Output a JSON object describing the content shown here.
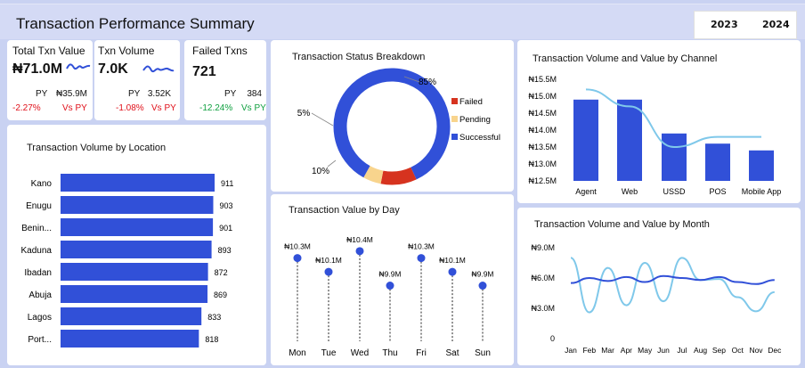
{
  "header": {
    "title": "Transaction Performance Summary",
    "years": [
      "2023",
      "2024"
    ]
  },
  "kpis": [
    {
      "label": "Total Txn Value",
      "value": "₦71.0M",
      "py_label": "PY",
      "py_value": "₦35.9M",
      "change": "-2.27%",
      "vs": "Vs PY",
      "trend": "negative"
    },
    {
      "label": "Txn Volume",
      "value": "7.0K",
      "py_label": "PY",
      "py_value": "3.52K",
      "change": "-1.08%",
      "vs": "Vs PY",
      "trend": "negative"
    },
    {
      "label": "Failed Txns",
      "value": "721",
      "py_label": "PY",
      "py_value": "384",
      "change": "-12.24%",
      "vs": "Vs PY",
      "trend": "positive"
    }
  ],
  "colors": {
    "primary": "#3150d8",
    "light_line": "#7fc8ea",
    "failed": "#d6331f",
    "pending": "#f8d48d",
    "negative": "#e0101a",
    "positive": "#10a040"
  },
  "chart_data": [
    {
      "type": "bar",
      "title": "Transaction Volume by Location",
      "orientation": "horizontal",
      "categories": [
        "Kano",
        "Enugu",
        "Benin...",
        "Kaduna",
        "Ibadan",
        "Abuja",
        "Lagos",
        "Port..."
      ],
      "values": [
        911,
        903,
        901,
        893,
        872,
        869,
        833,
        818
      ],
      "data_labels": [
        "911",
        "903",
        "901",
        "893",
        "872",
        "869",
        "833",
        "818"
      ]
    },
    {
      "type": "pie",
      "title": "Transaction Status Breakdown",
      "donut": true,
      "categories": [
        "Failed",
        "Pending",
        "Successful"
      ],
      "values": [
        10,
        5,
        85
      ],
      "data_labels": [
        "10%",
        "5%",
        "85%"
      ],
      "legend": "right"
    },
    {
      "type": "scatter",
      "title": "Transaction Value by Day",
      "style": "lollipop",
      "categories": [
        "Mon",
        "Tue",
        "Wed",
        "Thu",
        "Fri",
        "Sat",
        "Sun"
      ],
      "values": [
        10.3,
        10.1,
        10.4,
        9.9,
        10.3,
        10.1,
        9.9
      ],
      "data_labels": [
        "₦10.3M",
        "₦10.1M",
        "₦10.4M",
        "₦9.9M",
        "₦10.3M",
        "₦10.1M",
        "₦9.9M"
      ]
    },
    {
      "type": "bar",
      "title": "Transaction Volume and Value by Channel",
      "categories": [
        "Agent",
        "Web",
        "USSD",
        "POS",
        "Mobile App"
      ],
      "series": [
        {
          "type": "bar",
          "values": [
            14.9,
            14.9,
            13.9,
            13.6,
            13.4
          ]
        },
        {
          "type": "line",
          "values": [
            15.2,
            14.7,
            13.5,
            13.8,
            13.8
          ]
        }
      ],
      "y_ticks": [
        "₦15.5M",
        "₦15.0M",
        "₦14.5M",
        "₦14.0M",
        "₦13.5M",
        "₦13.0M",
        "₦12.5M"
      ],
      "ylim": [
        12.5,
        15.5
      ]
    },
    {
      "type": "line",
      "title": "Transaction Volume and Value by Month",
      "categories": [
        "Jan",
        "Feb",
        "Mar",
        "Apr",
        "May",
        "Jun",
        "Jul",
        "Aug",
        "Sep",
        "Oct",
        "Nov",
        "Dec"
      ],
      "series": [
        {
          "values": [
            5.5,
            6.0,
            5.7,
            6.1,
            5.6,
            6.2,
            6.0,
            5.8,
            6.1,
            5.6,
            5.4,
            5.8
          ]
        },
        {
          "values": [
            8.0,
            2.6,
            7.0,
            3.3,
            7.5,
            3.7,
            8.0,
            5.8,
            5.9,
            4.1,
            2.7,
            4.6
          ]
        }
      ],
      "y_ticks": [
        "₦9.0M",
        "₦6.0M",
        "₦3.0M",
        "0"
      ],
      "ylim": [
        0,
        9
      ]
    }
  ]
}
